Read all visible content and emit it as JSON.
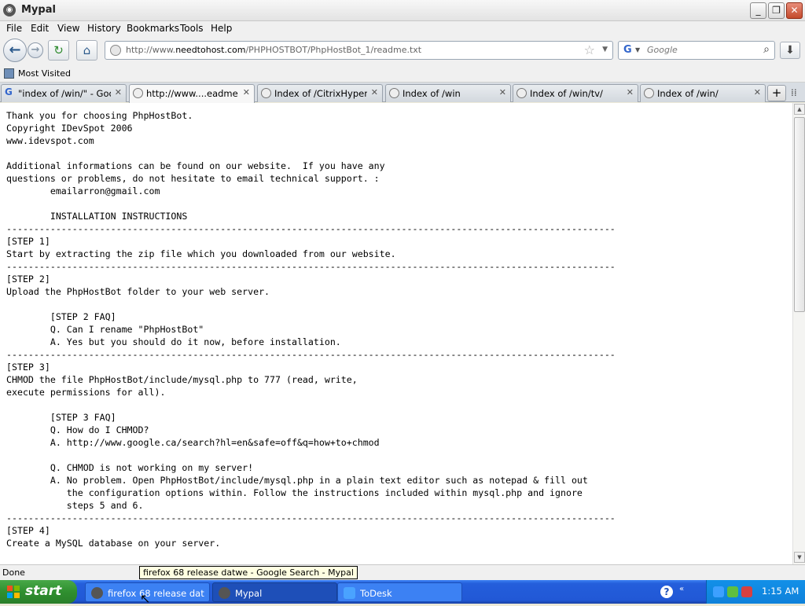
{
  "window": {
    "title": "Mypal",
    "app_icon": "mypal-icon",
    "controls": {
      "minimize": "_",
      "maximize": "❐",
      "close": "✕"
    }
  },
  "menu": {
    "items": [
      "File",
      "Edit",
      "View",
      "History",
      "Bookmarks",
      "Tools",
      "Help"
    ]
  },
  "nav": {
    "back_icon": "←",
    "forward_icon": "→",
    "reload_icon": "↻",
    "home_icon": "⌂",
    "url_prefix": "http://www.",
    "url_domain": "needtohost.com",
    "url_path": "/PHPHOSTBOT/PhpHostBot_1/readme.txt",
    "bookmark_star": "☆",
    "url_dropdown": "▼",
    "search_engine_letter": "G",
    "search_dropdown": "▼",
    "search_placeholder": "Google",
    "search_icon": "⌕",
    "download_icon": "⬇"
  },
  "bookmarks": {
    "most_visited": "Most Visited"
  },
  "tabs": [
    {
      "label": "\"index of /win/\" - Goog...",
      "icon": "google",
      "active": false
    },
    {
      "label": "http://www....eadme.txt",
      "icon": "globe",
      "active": true
    },
    {
      "label": "Index of /CitrixHyperv...",
      "icon": "globe",
      "active": false
    },
    {
      "label": "Index of /win",
      "icon": "globe",
      "active": false
    },
    {
      "label": "Index of /win/tv/",
      "icon": "globe",
      "active": false
    },
    {
      "label": "Index of /win/",
      "icon": "globe",
      "active": false
    }
  ],
  "tab_controls": {
    "close": "✕",
    "new_tab": "+",
    "list_all": "⁞⁞"
  },
  "document": {
    "text": "Thank you for choosing PhpHostBot.\nCopyright IDevSpot 2006\nwww.idevspot.com\n\nAdditional informations can be found on our website.  If you have any\nquestions or problems, do not hesitate to email technical support. :\n        emailarron@gmail.com\n\n        INSTALLATION INSTRUCTIONS\n---------------------------------------------------------------------------------------------------------------\n[STEP 1]\nStart by extracting the zip file which you downloaded from our website.\n---------------------------------------------------------------------------------------------------------------\n[STEP 2]\nUpload the PhpHostBot folder to your web server.\n\n        [STEP 2 FAQ]\n        Q. Can I rename \"PhpHostBot\"\n        A. Yes but you should do it now, before installation.\n---------------------------------------------------------------------------------------------------------------\n[STEP 3]\nCHMOD the file PhpHostBot/include/mysql.php to 777 (read, write,\nexecute permissions for all).\n\n        [STEP 3 FAQ]\n        Q. How do I CHMOD?\n        A. http://www.google.ca/search?hl=en&safe=off&q=how+to+chmod\n\n        Q. CHMOD is not working on my server!\n        A. No problem. Open PhpHostBot/include/mysql.php in a plain text editor such as notepad & fill out\n           the configuration options within. Follow the instructions included within mysql.php and ignore\n           steps 5 and 6.\n---------------------------------------------------------------------------------------------------------------\n[STEP 4]\nCreate a MySQL database on your server."
  },
  "scrollbar": {
    "up": "▲",
    "down": "▼",
    "scroll_fraction": 0.0
  },
  "status": {
    "text": "Done",
    "tooltip": "firefox 68 release datwe - Google Search - Mypal"
  },
  "taskbar": {
    "start_label": "start",
    "tasks": [
      {
        "label": "firefox 68 release dat...",
        "icon": "mypal",
        "pressed": false
      },
      {
        "label": "Mypal",
        "icon": "mypal",
        "pressed": true
      },
      {
        "label": "ToDesk",
        "icon": "todesk",
        "pressed": false
      }
    ],
    "help_icon": "?",
    "tray_arrow": "«",
    "clock": "1:15 AM"
  },
  "colors": {
    "taskbar_blue": "#245edb",
    "start_green": "#2f8f2f",
    "tray_blue": "#0f81da",
    "tooltip_bg": "#ffffe1"
  }
}
